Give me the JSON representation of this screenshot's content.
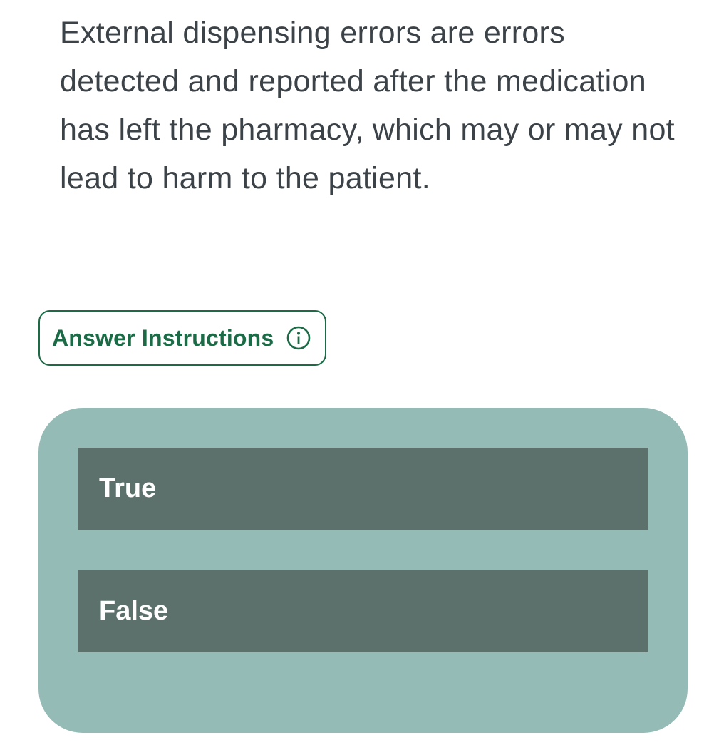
{
  "question": {
    "text": "External dispensing errors are errors detected and reported after the medication has left the pharmacy, which may or may not lead to harm to the patient."
  },
  "instructions_button": {
    "label": "Answer Instructions",
    "icon": "info-icon"
  },
  "answers": {
    "options": [
      {
        "label": "True"
      },
      {
        "label": "False"
      }
    ]
  },
  "colors": {
    "text": "#3b4248",
    "accent_green": "#1a6b46",
    "panel_bg": "#95bbb7",
    "option_bg": "#5c716b",
    "option_text": "#ffffff"
  }
}
